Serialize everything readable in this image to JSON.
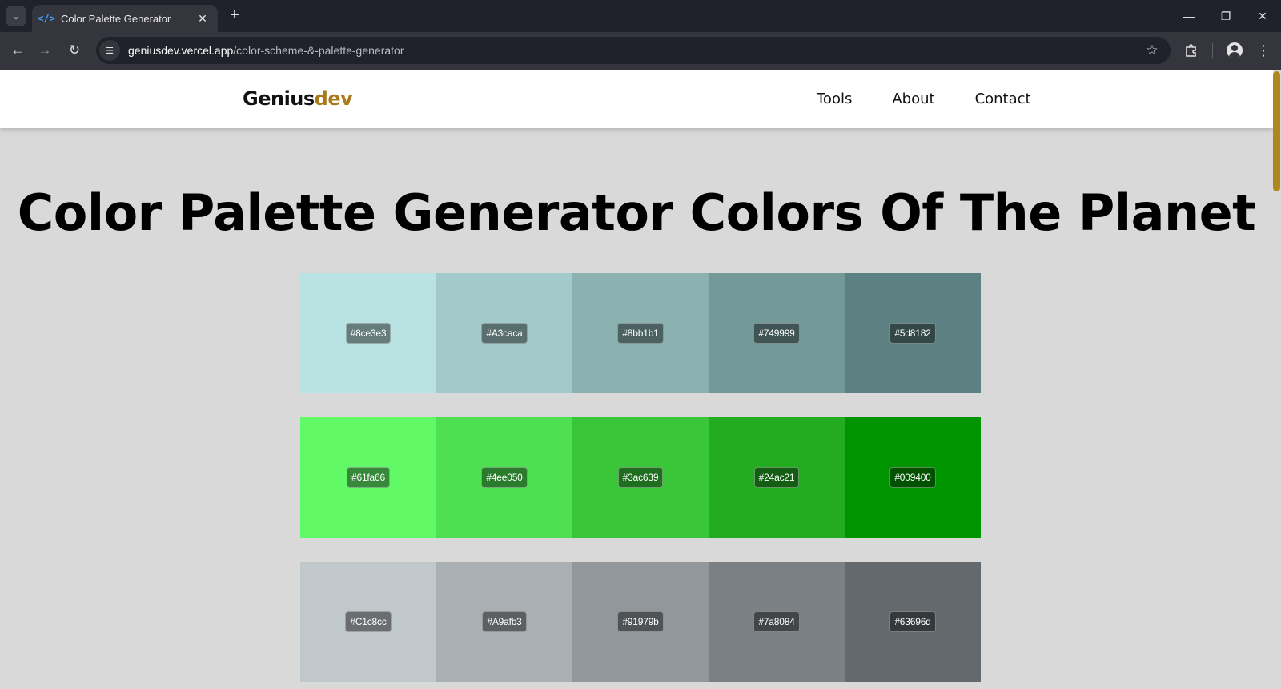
{
  "browser": {
    "tab_title": "Color Palette Generator",
    "url_host": "geniusdev.vercel.app",
    "url_path": "/color-scheme-&-palette-generator"
  },
  "site": {
    "logo_part1": "Genius",
    "logo_part2": "dev",
    "nav": [
      "Tools",
      "About",
      "Contact"
    ]
  },
  "page": {
    "title": "Color Palette Generator Colors Of The Planet"
  },
  "palettes": [
    {
      "colors": [
        "#8ce3e3",
        "#A3caca",
        "#8bb1b1",
        "#749999",
        "#5d8182"
      ],
      "swatch_fill": [
        "#b9e3e3",
        "#a3caca",
        "#8bb1b1",
        "#749999",
        "#5d8182"
      ]
    },
    {
      "colors": [
        "#61fa66",
        "#4ee050",
        "#3ac639",
        "#24ac21",
        "#009400"
      ],
      "swatch_fill": [
        "#61fa66",
        "#4ee050",
        "#3ac639",
        "#24ac21",
        "#009400"
      ]
    },
    {
      "colors": [
        "#C1c8cc",
        "#A9afb3",
        "#91979b",
        "#7a8084",
        "#63696d"
      ],
      "swatch_fill": [
        "#c1c8cc",
        "#a9afb3",
        "#91979b",
        "#7a8084",
        "#63696d"
      ]
    }
  ]
}
